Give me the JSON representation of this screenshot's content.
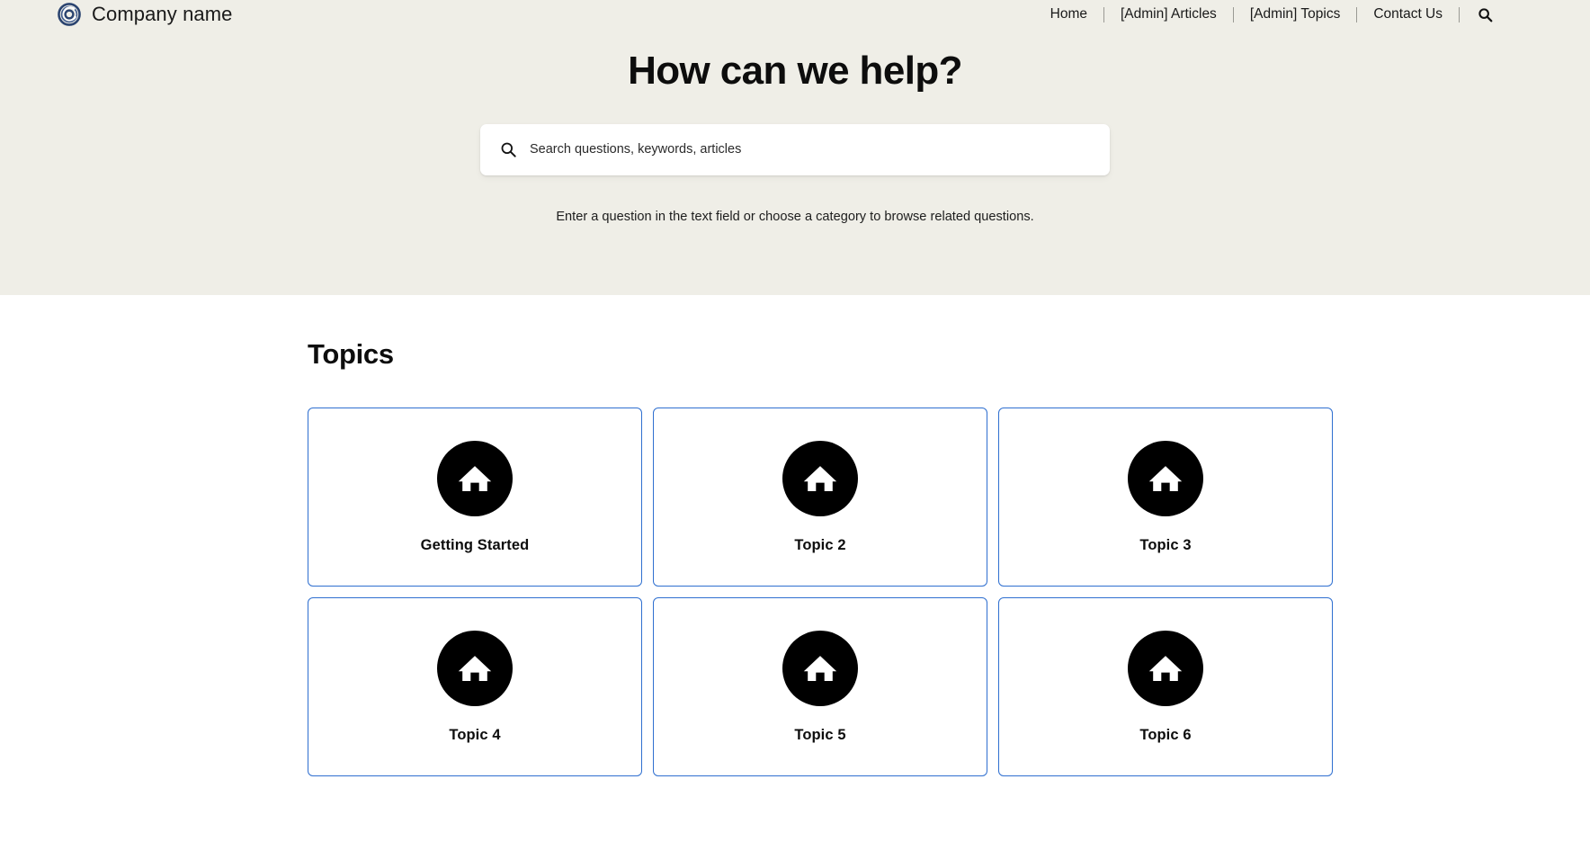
{
  "brand": {
    "name": "Company name",
    "logo_icon": "spiral-circle-logo",
    "logo_color": "#2b4470"
  },
  "nav": {
    "items": [
      {
        "label": "Home",
        "name": "home"
      },
      {
        "label": "[Admin] Articles",
        "name": "admin-articles"
      },
      {
        "label": "[Admin] Topics",
        "name": "admin-topics"
      },
      {
        "label": "Contact Us",
        "name": "contact-us"
      }
    ],
    "search_icon": "search-icon"
  },
  "hero": {
    "title": "How can we help?",
    "subtitle": "Enter a question in the text field or choose a category to browse related questions.",
    "background_color": "#efeee7"
  },
  "search": {
    "placeholder": "Search questions, keywords, articles",
    "value": "",
    "icon": "search-icon"
  },
  "topics": {
    "heading": "Topics",
    "card_border_color": "#2f6fd0",
    "icon_background_color": "#000000",
    "cards": [
      {
        "label": "Getting Started",
        "icon": "home-icon"
      },
      {
        "label": "Topic 2",
        "icon": "home-icon"
      },
      {
        "label": "Topic 3",
        "icon": "home-icon"
      },
      {
        "label": "Topic 4",
        "icon": "home-icon"
      },
      {
        "label": "Topic 5",
        "icon": "home-icon"
      },
      {
        "label": "Topic 6",
        "icon": "home-icon"
      }
    ]
  }
}
